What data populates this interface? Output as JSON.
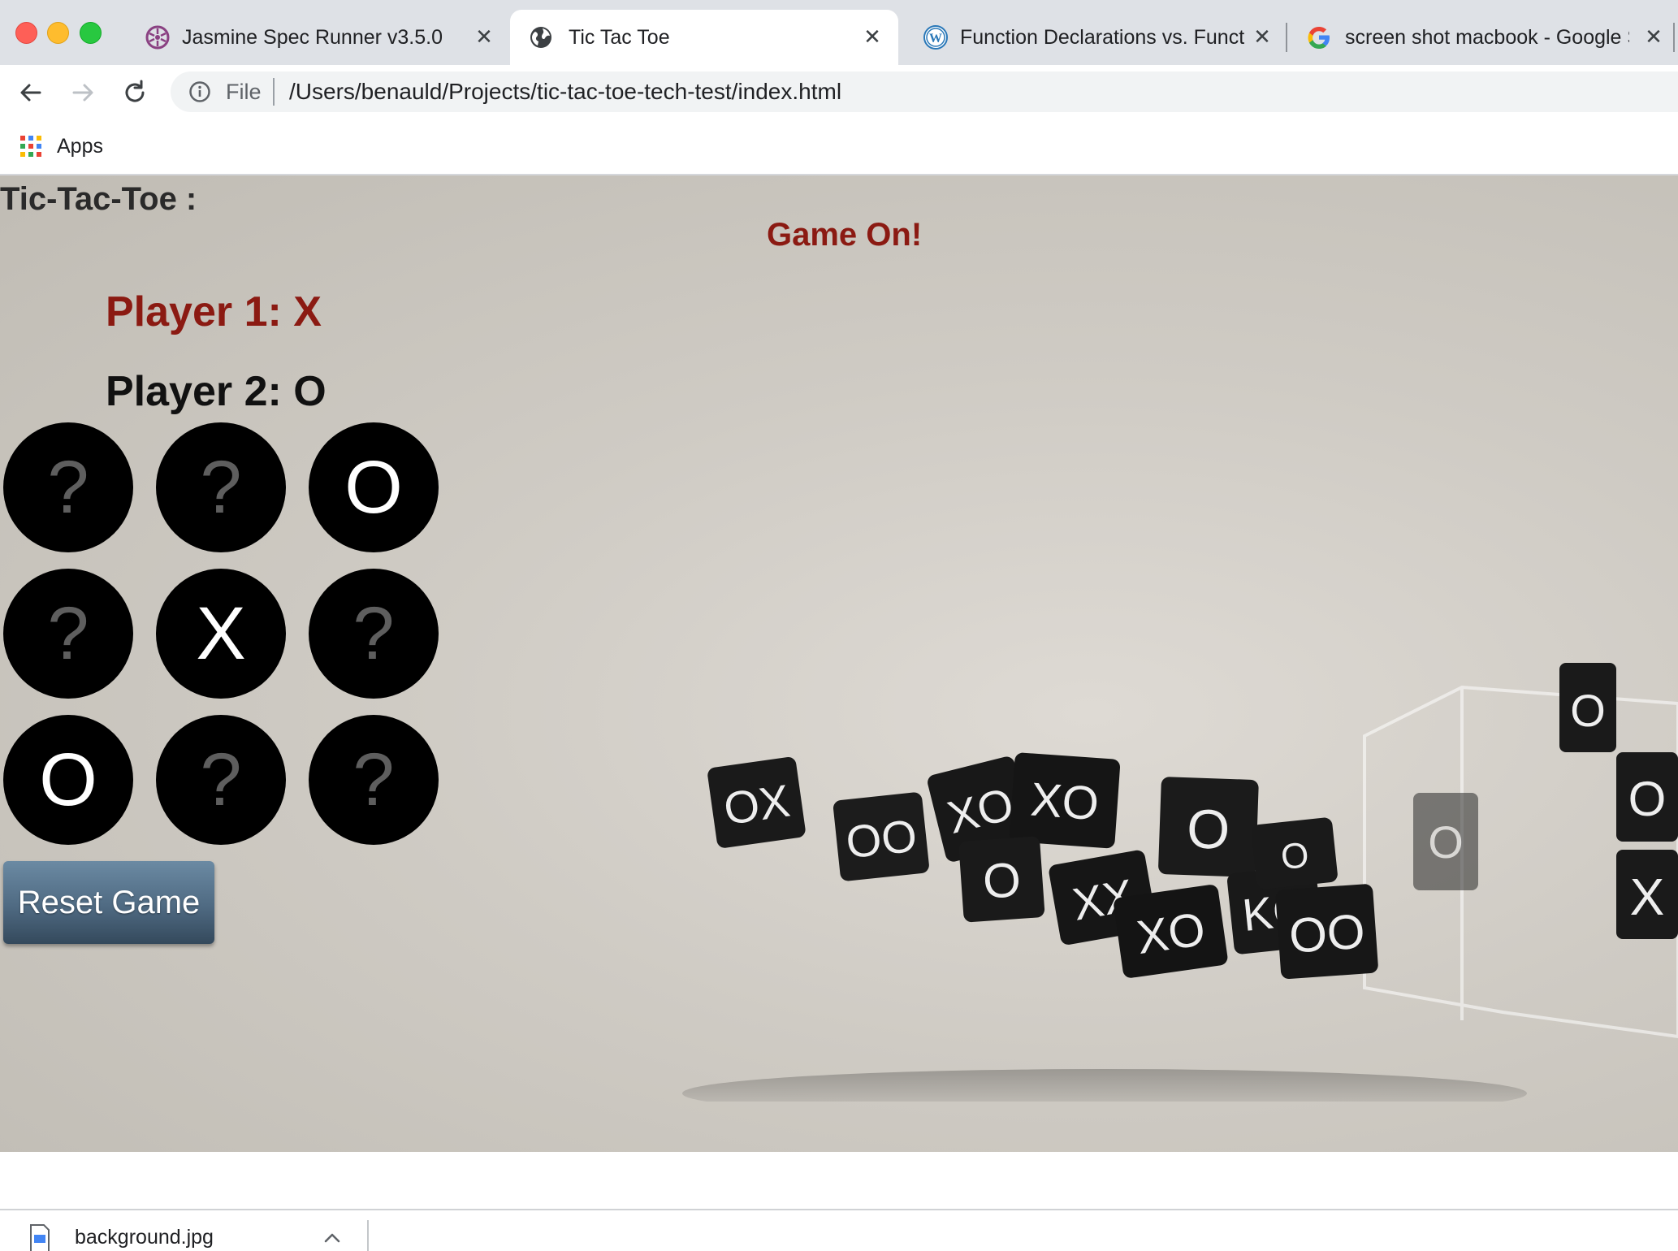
{
  "browser": {
    "tabs": [
      {
        "title": "Jasmine Spec Runner v3.5.0",
        "icon": "jasmine-icon",
        "active": false
      },
      {
        "title": "Tic Tac Toe",
        "icon": "globe-icon",
        "active": true
      },
      {
        "title": "Function Declarations vs. Function",
        "icon": "wordpress-icon",
        "active": false
      },
      {
        "title": "screen shot macbook - Google S",
        "icon": "google-icon",
        "active": false
      }
    ],
    "address": {
      "scheme": "File",
      "path": "/Users/benauld/Projects/tic-tac-toe-tech-test/index.html"
    },
    "bookmarks": [
      {
        "label": "Apps",
        "icon": "apps-grid-icon"
      }
    ]
  },
  "page": {
    "title": "Tic-Tac-Toe :",
    "status": "Game On!",
    "player1": "Player 1: X",
    "player2": "Player 2: O",
    "board": [
      "?",
      "?",
      "O",
      "?",
      "X",
      "?",
      "O",
      "?",
      "?"
    ],
    "reset_label": "Reset Game",
    "colors": {
      "status": "#8b1a12",
      "player1": "#8b1a12",
      "cell": "#000000",
      "empty_mark": "#5e5e5e",
      "filled_mark": "#ffffff"
    }
  },
  "downloads": {
    "items": [
      {
        "name": "background.jpg",
        "icon": "image-file-icon"
      }
    ]
  }
}
